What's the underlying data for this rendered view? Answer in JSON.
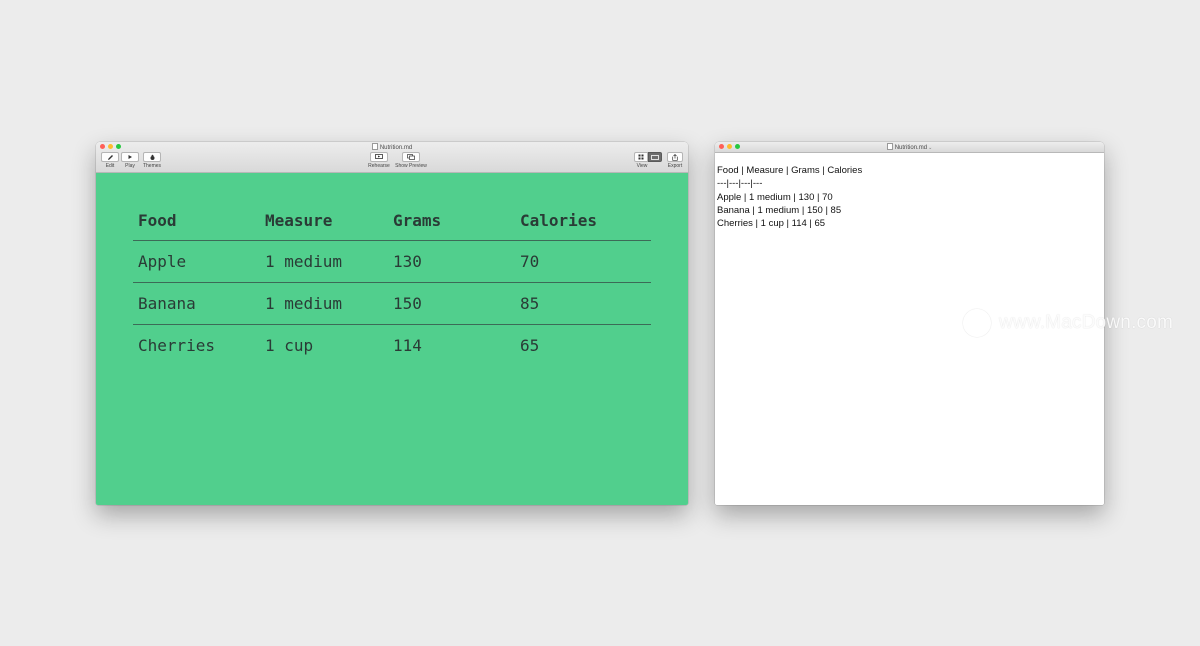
{
  "main_window": {
    "title": "Nutrition.md",
    "toolbar": {
      "edit_label": "Edit",
      "play_label": "Play",
      "themes_label": "Themes",
      "rehearse_label": "Rehearse",
      "show_preview_label": "Show Preview",
      "view_label": "View",
      "export_label": "Export"
    },
    "slide_bg_color": "#51cf8d",
    "table": {
      "headers": [
        "Food",
        "Measure",
        "Grams",
        "Calories"
      ],
      "rows": [
        [
          "Apple",
          "1 medium",
          "130",
          "70"
        ],
        [
          "Banana",
          "1 medium",
          "150",
          "85"
        ],
        [
          "Cherries",
          "1 cup",
          "114",
          "65"
        ]
      ]
    }
  },
  "preview_window": {
    "title": "Nutrition.md",
    "lines": [
      "Food | Measure | Grams | Calories",
      "---|---|---|---",
      "Apple | 1 medium | 130 | 70",
      "Banana | 1 medium | 150 | 85",
      "Cherries | 1 cup | 114 | 65"
    ]
  },
  "watermark": "www.MacDown.com"
}
